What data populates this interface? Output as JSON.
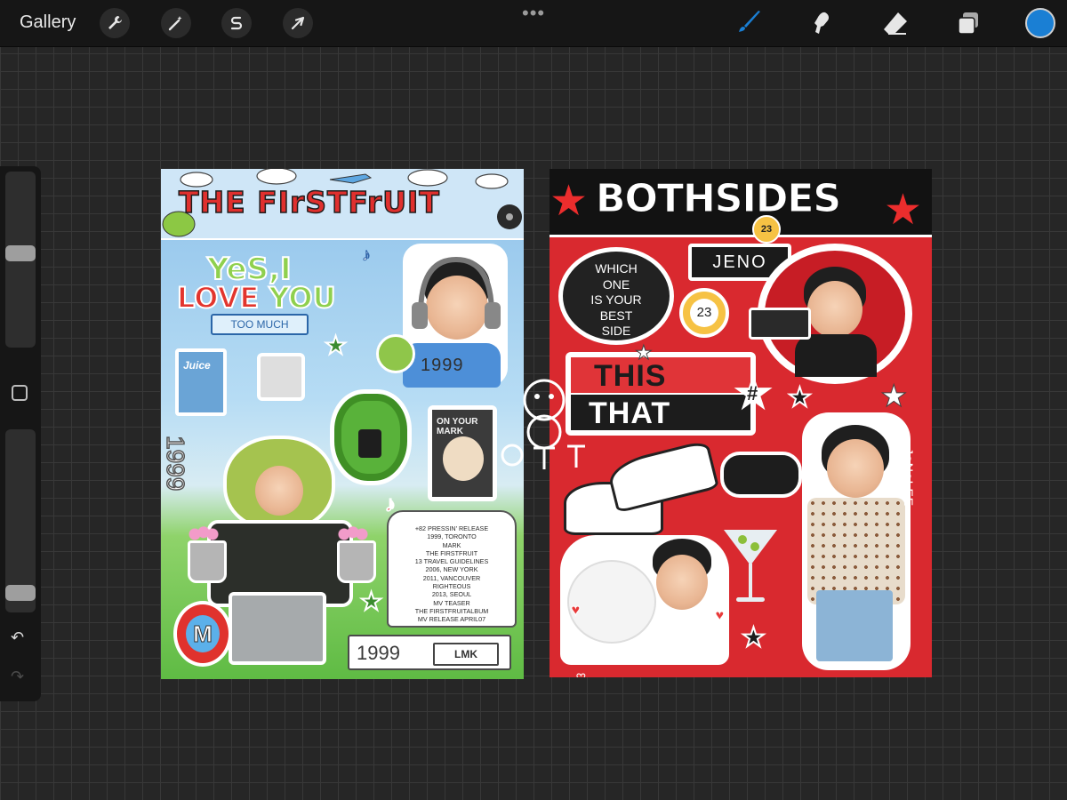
{
  "toolbar": {
    "gallery_label": "Gallery",
    "tools": [
      {
        "icon": "wrench-icon",
        "name": "actions"
      },
      {
        "icon": "magic-wand-icon",
        "name": "adjustments"
      },
      {
        "icon": "selection-s-icon",
        "name": "selection"
      },
      {
        "icon": "arrow-cursor-icon",
        "name": "transform"
      }
    ],
    "right_tools": [
      {
        "icon": "brush-icon",
        "name": "brush",
        "active": true
      },
      {
        "icon": "smudge-icon",
        "name": "smudge"
      },
      {
        "icon": "eraser-icon",
        "name": "eraser"
      },
      {
        "icon": "layers-icon",
        "name": "layers"
      }
    ],
    "more_label": "•••",
    "current_color": "#1a7fd4"
  },
  "sidebar": {
    "brush_size_level": 0.54,
    "opacity_level": 0.07,
    "undo_label": "↶",
    "redo_label": "↷"
  },
  "sheet1": {
    "title": "THE FIrSTFrUIT",
    "yes_text": "YeS,I",
    "love_word": "LOVE",
    "you_word": "YOU",
    "too_much": "TOO MUCH",
    "juice_label": "Juice",
    "year_tag": "1999",
    "vertical_year": "1999",
    "mark_card_title": "ON YOUR MARK",
    "m_badge": "M",
    "tshirt_lines": [
      "+82 PRESSIN' RELEASE",
      "1999, TORONTO",
      "MARK",
      "THE FIRSTFRUIT",
      "13 TRAVEL GUIDELINES",
      "2006, NEW YORK",
      "2011, VANCOUVER",
      "RIGHTEOUS",
      "2013, SEOUL",
      "MV TEASER",
      "THE FIRSTFRUITALBUM",
      "MV RELEASE APRIL07"
    ],
    "bottom_tag_year": "1999",
    "bottom_tag_initials": "LMK"
  },
  "sheet2": {
    "title": "BOTHSIDES",
    "header_ball": "23",
    "which_lines": [
      "WHICH",
      "ONE",
      "IS YOUR",
      "BEST",
      "SIDE"
    ],
    "name_tag": "JENO",
    "ball_number": "23",
    "this_text": "THIS",
    "that_text": "THAT",
    "hash_symbol": "#",
    "vertical_name": "JoNoLEE"
  },
  "colors": {
    "canvas_bg": "#262626",
    "sheet1_red": "#e0302e",
    "sheet1_green": "#8fd04e",
    "sheet2_red": "#d9292f",
    "accent_blue": "#1a7fd4"
  }
}
